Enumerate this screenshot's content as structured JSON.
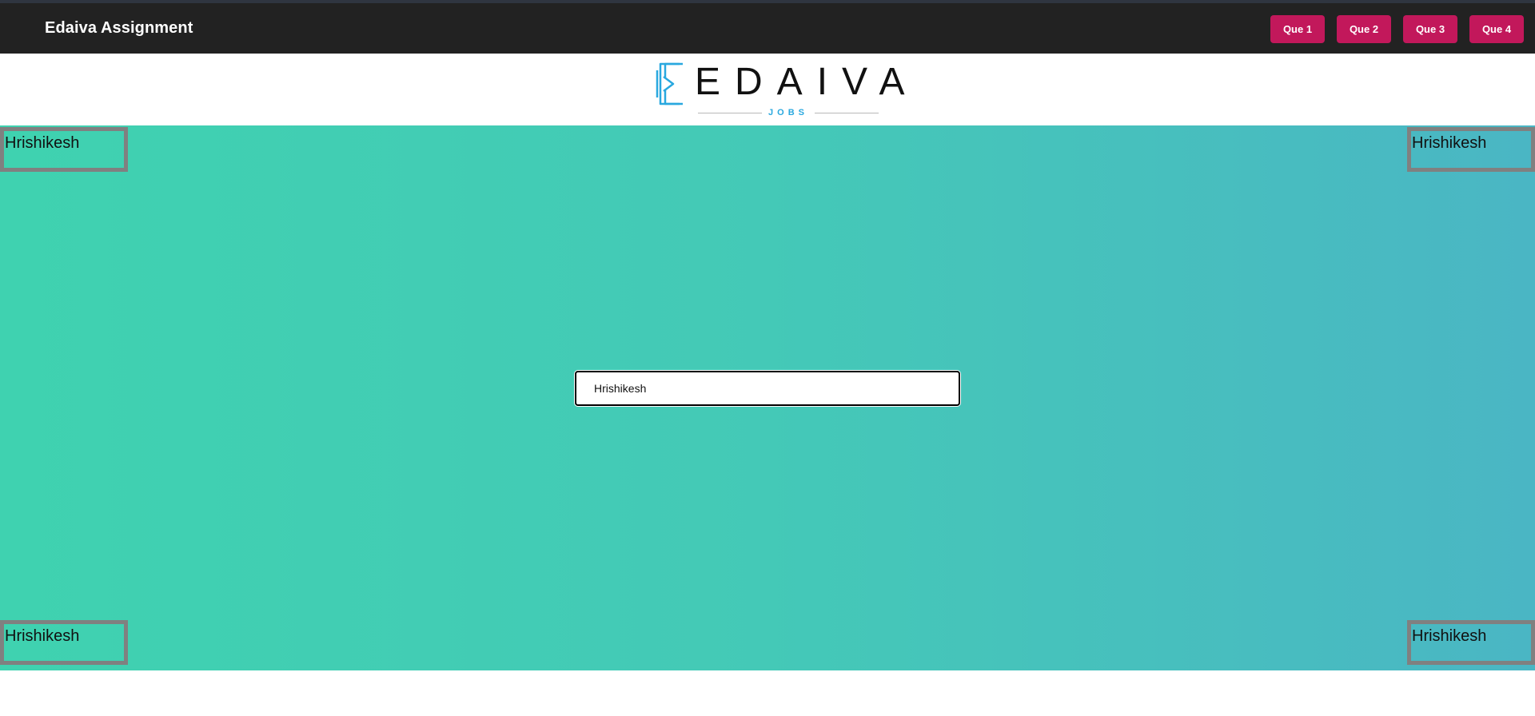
{
  "navbar": {
    "title": "Edaiva Assignment",
    "buttons": [
      "Que 1",
      "Que 2",
      "Que 3",
      "Que 4"
    ]
  },
  "logo": {
    "word": "EDAIVA",
    "sub": "JOBS"
  },
  "corners": {
    "top_left": "Hrishikesh",
    "top_right": "Hrishikesh",
    "bottom_left": "Hrishikesh",
    "bottom_right": "Hrishikesh"
  },
  "search": {
    "value": "Hrishikesh "
  },
  "colors": {
    "navbar_bg": "#222222",
    "button_bg": "#c2185b",
    "gradient_start": "#3fd2b0",
    "gradient_end": "#4ab6c4",
    "logo_accent": "#29a8df"
  }
}
